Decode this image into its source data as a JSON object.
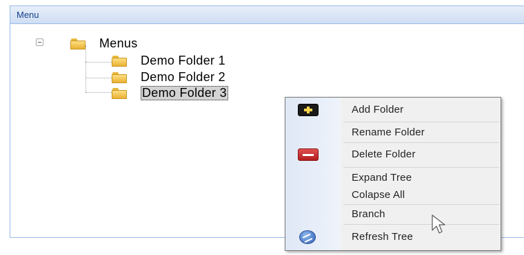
{
  "panel": {
    "title": "Menu"
  },
  "tree": {
    "root": {
      "label": "Menus",
      "icon": "folder-icon",
      "expanded": true
    },
    "children": [
      {
        "label": "Demo Folder 1",
        "icon": "folder-icon",
        "selected": false
      },
      {
        "label": "Demo Folder 2",
        "icon": "folder-icon",
        "selected": false
      },
      {
        "label": "Demo Folder 3",
        "icon": "folder-icon",
        "selected": true
      }
    ]
  },
  "context_menu": {
    "items": [
      {
        "label": "Add Folder",
        "icon": "add-folder-icon"
      },
      {
        "label": "Rename Folder",
        "icon": ""
      },
      {
        "label": "Delete Folder",
        "icon": "delete-folder-icon"
      },
      {
        "label": "Expand Tree",
        "icon": ""
      },
      {
        "label": "Colapse All",
        "icon": ""
      },
      {
        "label": "Branch",
        "icon": ""
      },
      {
        "label": "Refresh Tree",
        "icon": "refresh-icon"
      }
    ]
  },
  "colors": {
    "panel_border": "#99bbe8",
    "panel_title": "#15428b",
    "menu_background": "#f0f0f0"
  }
}
